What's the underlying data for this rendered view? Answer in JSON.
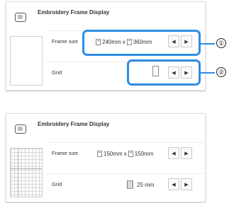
{
  "top_panel": {
    "title": "Embroidery Frame Display",
    "frame_size_label": "Frame size",
    "frame_size_w": "240mm",
    "frame_size_sep": "x",
    "frame_size_h": "360mm",
    "grid_label": "Grid",
    "grid_value": ""
  },
  "bottom_panel": {
    "title": "Embroidery Frame Display",
    "frame_size_label": "Frame size",
    "frame_size_w": "150mm",
    "frame_size_sep": "x",
    "frame_size_h": "150mm",
    "grid_label": "Grid",
    "grid_value": "25 mm"
  },
  "buttons": {
    "prev": "◀",
    "next": "▶"
  },
  "callouts": [
    "①",
    "②"
  ],
  "colors": {
    "callout": "#2f8de4"
  }
}
